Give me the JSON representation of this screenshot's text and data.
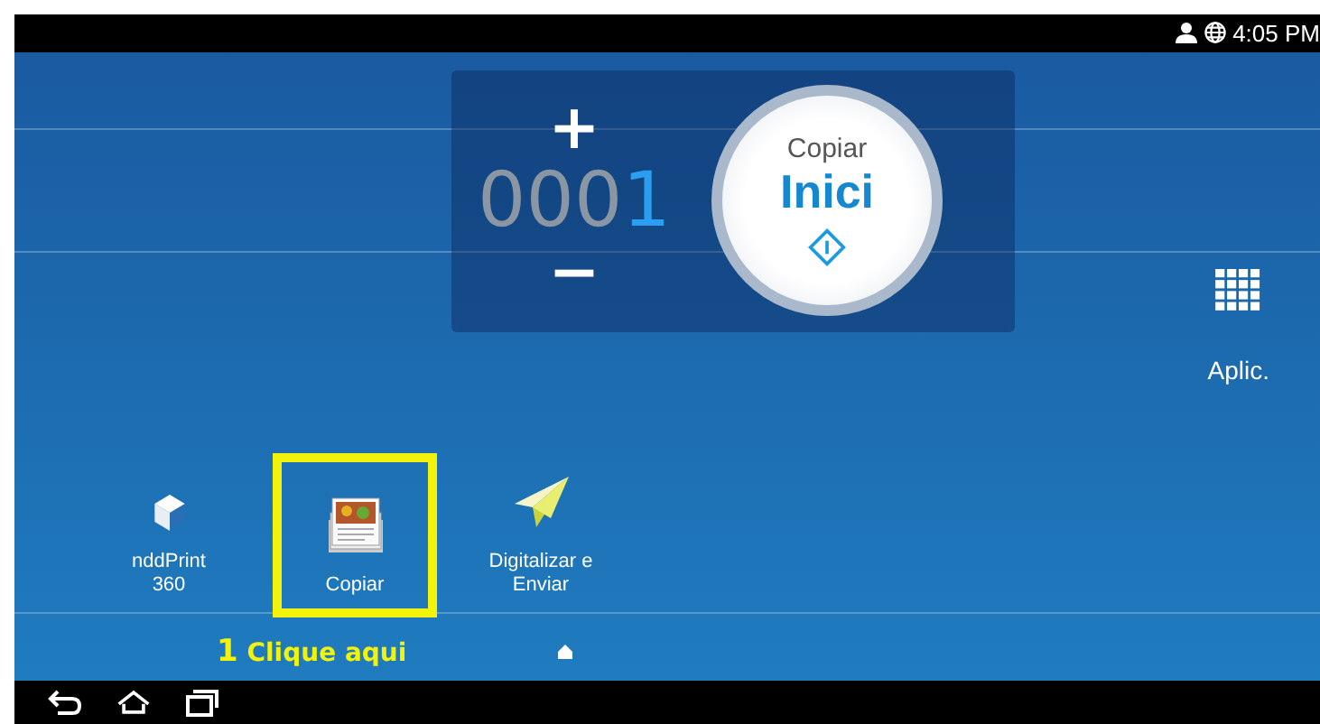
{
  "status_bar": {
    "time": "4:05 PM"
  },
  "copy_panel": {
    "count_leading": "000",
    "count_last": "1",
    "increase": "+",
    "decrease": "−",
    "start_button": {
      "title": "Copiar",
      "label": "Inici"
    }
  },
  "apps_button": {
    "label": "Aplic."
  },
  "apps": [
    {
      "kind": "cube",
      "label": "nddPrint 360",
      "highlighted": false
    },
    {
      "kind": "copy",
      "label": "Copiar",
      "highlighted": true
    },
    {
      "kind": "plane",
      "label": "Digitalizar e Enviar",
      "highlighted": false
    }
  ],
  "annotation": {
    "number": "1",
    "text": "Clique aqui"
  }
}
